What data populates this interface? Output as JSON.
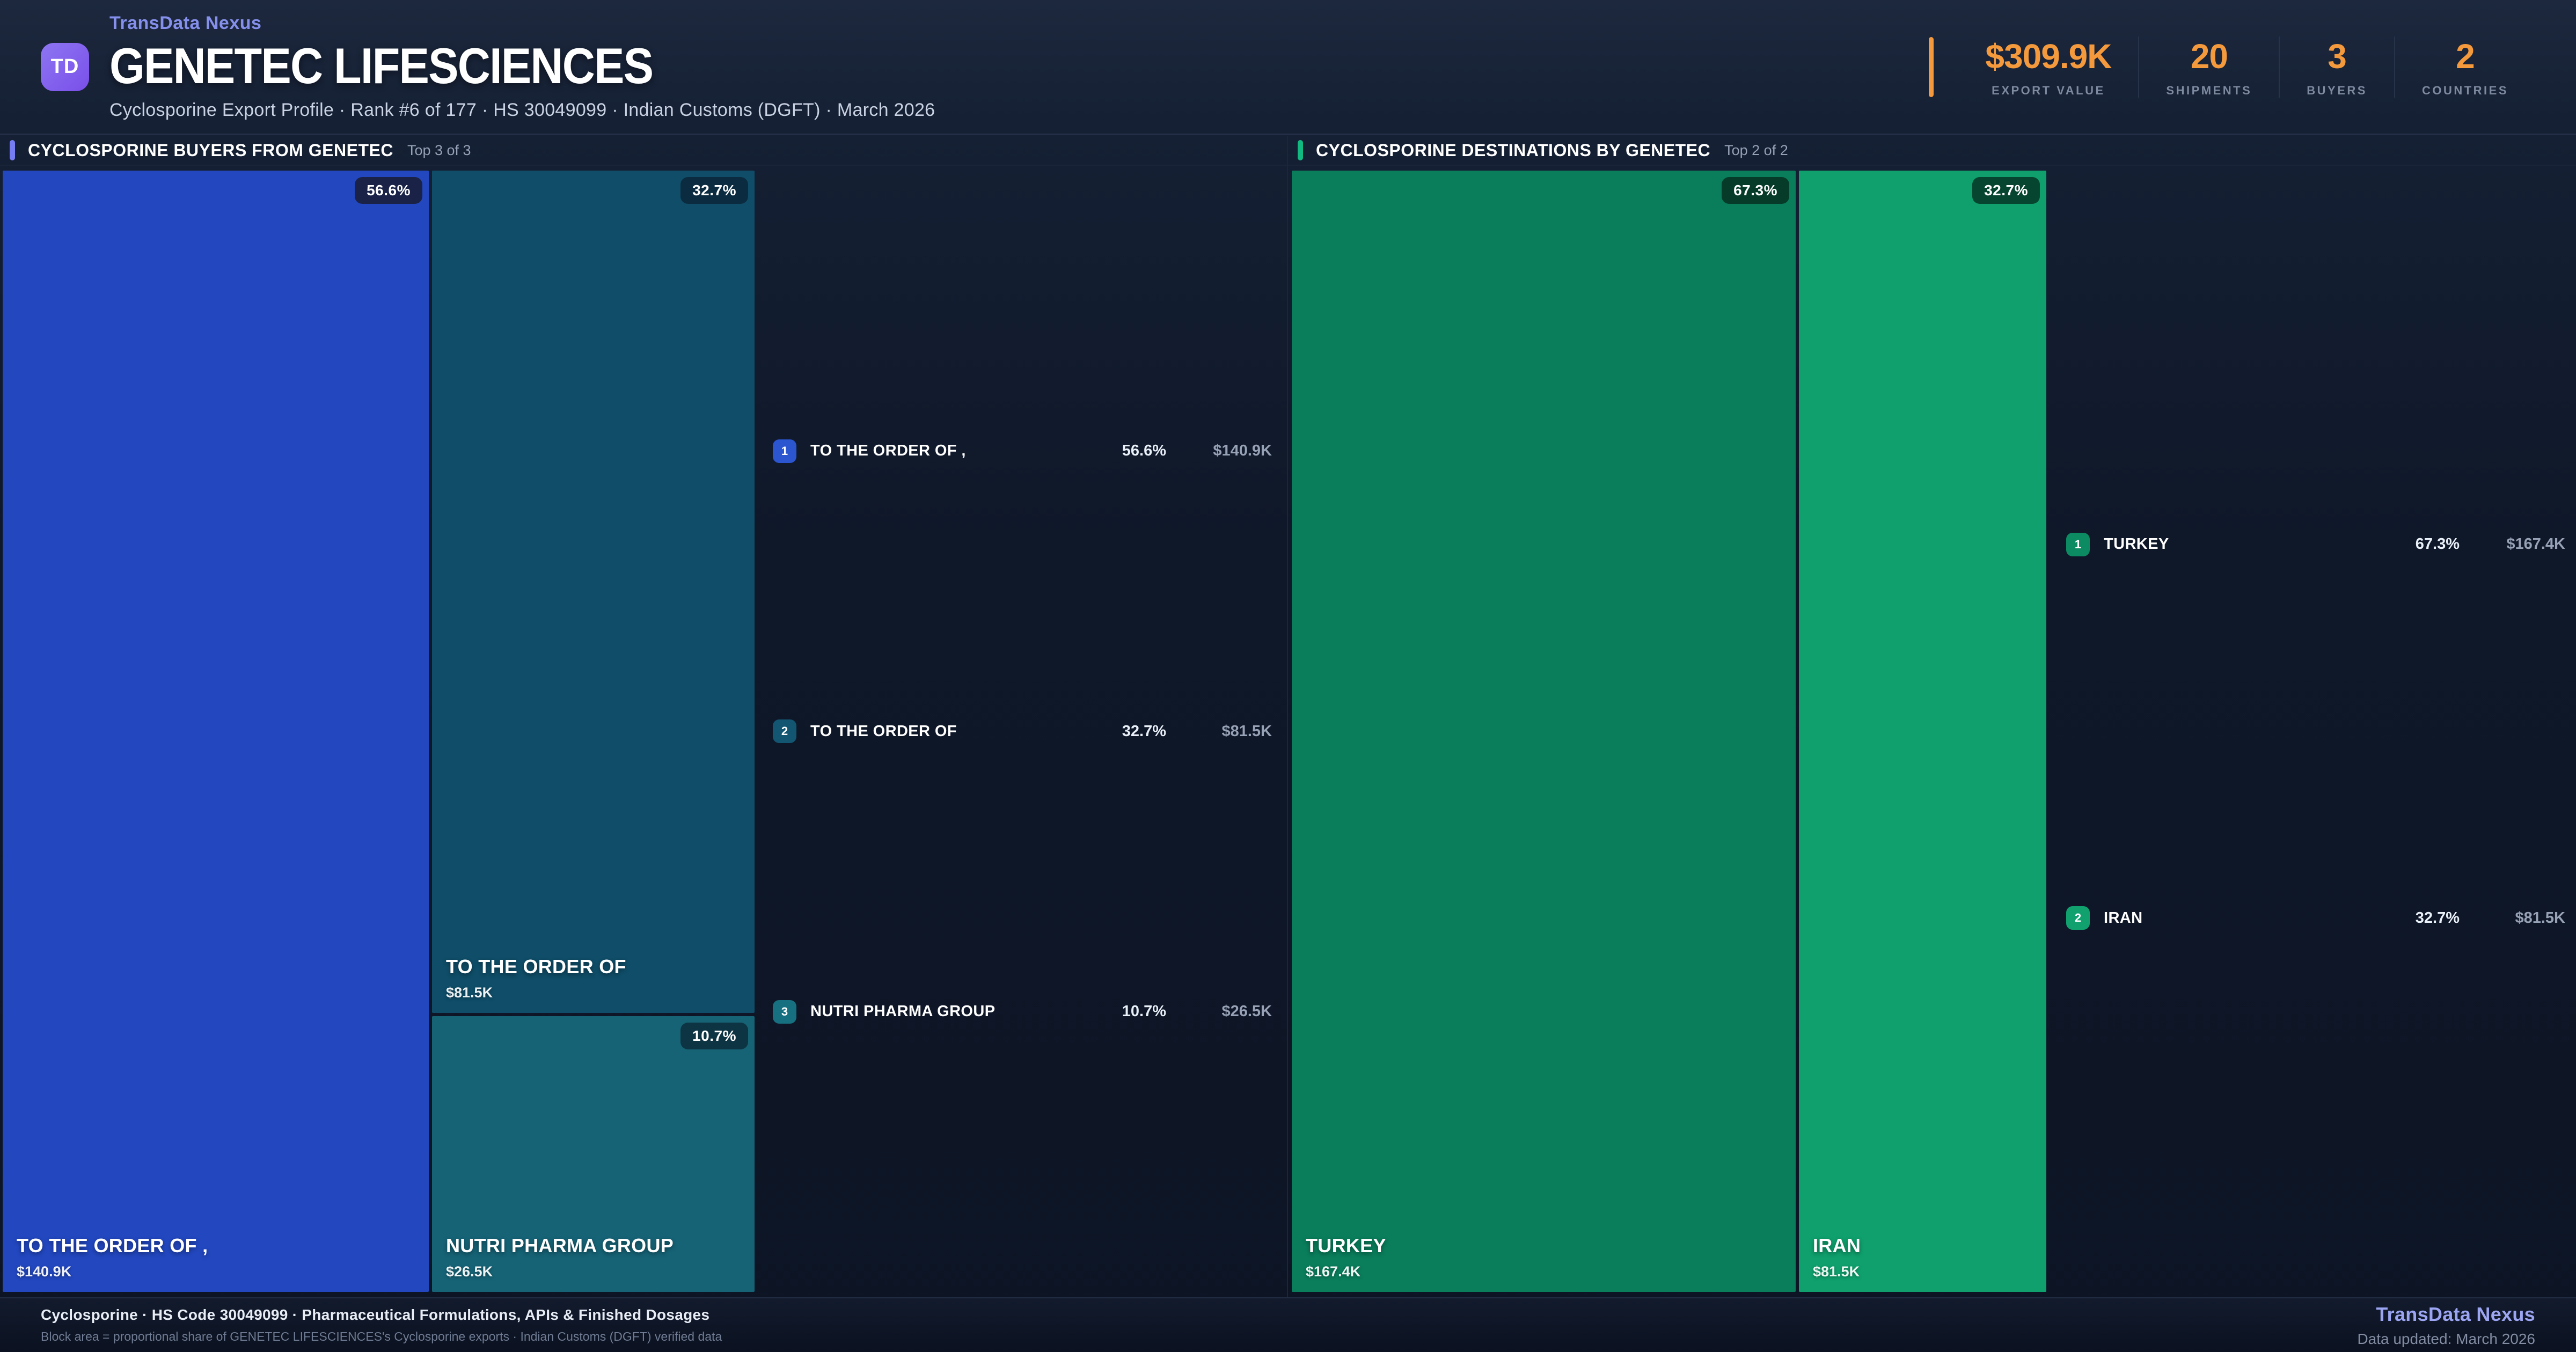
{
  "brand": {
    "logo": "TD",
    "name": "TransData Nexus"
  },
  "header": {
    "title": "GENETEC LIFESCIENCES",
    "subtitle": "Cyclosporine Export Profile · Rank #6 of 177 · HS 30049099 · Indian Customs (DGFT) · March 2026",
    "accent_color": "#f59a3c",
    "stats": [
      {
        "value": "$309.9K",
        "label": "EXPORT VALUE"
      },
      {
        "value": "20",
        "label": "SHIPMENTS"
      },
      {
        "value": "3",
        "label": "BUYERS"
      },
      {
        "value": "2",
        "label": "COUNTRIES"
      }
    ]
  },
  "buyers": {
    "title": "CYCLOSPORINE BUYERS FROM GENETEC",
    "top_note": "Top 3 of 3",
    "accent_color": "#767df3",
    "blocks": [
      {
        "name": "TO THE ORDER OF ,",
        "value": "$140.9K",
        "pct": "56.6%",
        "color": "#2247bf",
        "chip_color": "#1a2347"
      },
      {
        "name": "TO THE ORDER OF",
        "value": "$81.5K",
        "pct": "32.7%",
        "color": "#0f4d68",
        "chip_color": "#0b2c40"
      },
      {
        "name": "NUTRI PHARMA GROUP",
        "value": "$26.5K",
        "pct": "10.7%",
        "color": "#166376",
        "chip_color": "#0d3443"
      }
    ],
    "list": [
      {
        "rank": "1",
        "name": "TO THE ORDER OF ,",
        "pct": "56.6%",
        "value": "$140.9K",
        "badge_color": "#2c55d0"
      },
      {
        "rank": "2",
        "name": "TO THE ORDER OF",
        "pct": "32.7%",
        "value": "$81.5K",
        "badge_color": "#135672"
      },
      {
        "rank": "3",
        "name": "NUTRI PHARMA GROUP",
        "pct": "10.7%",
        "value": "$26.5K",
        "badge_color": "#17707f"
      }
    ]
  },
  "destinations": {
    "title": "CYCLOSPORINE DESTINATIONS BY GENETEC",
    "top_note": "Top 2 of 2",
    "accent_color": "#12b981",
    "blocks": [
      {
        "name": "TURKEY",
        "value": "$167.4K",
        "pct": "67.3%",
        "color": "#0a7d5b",
        "chip_color": "#053b28"
      },
      {
        "name": "IRAN",
        "value": "$81.5K",
        "pct": "32.7%",
        "color": "#0fa06d",
        "chip_color": "#06452f"
      }
    ],
    "list": [
      {
        "rank": "1",
        "name": "TURKEY",
        "pct": "67.3%",
        "value": "$167.4K",
        "badge_color": "#0c8a62"
      },
      {
        "rank": "2",
        "name": "IRAN",
        "pct": "32.7%",
        "value": "$81.5K",
        "badge_color": "#10a16f"
      }
    ]
  },
  "footer": {
    "line1": "Cyclosporine · HS Code 30049099 · Pharmaceutical Formulations, APIs & Finished Dosages",
    "line2": "Block area = proportional share of GENETEC LIFESCIENCES's Cyclosporine exports · Indian Customs (DGFT) verified data",
    "brand": "TransData Nexus",
    "updated": "Data updated: March 2026"
  },
  "chart_data": [
    {
      "type": "treemap",
      "title": "CYCLOSPORINE BUYERS FROM GENETEC",
      "subtitle": "Top 3 of 3",
      "unit": "USD thousands",
      "items": [
        {
          "label": "TO THE ORDER OF ,",
          "share_pct": 56.6,
          "value_usd_k": 140.9
        },
        {
          "label": "TO THE ORDER OF",
          "share_pct": 32.7,
          "value_usd_k": 81.5
        },
        {
          "label": "NUTRI PHARMA GROUP",
          "share_pct": 10.7,
          "value_usd_k": 26.5
        }
      ]
    },
    {
      "type": "treemap",
      "title": "CYCLOSPORINE DESTINATIONS BY GENETEC",
      "subtitle": "Top 2 of 2",
      "unit": "USD thousands",
      "items": [
        {
          "label": "TURKEY",
          "share_pct": 67.3,
          "value_usd_k": 167.4
        },
        {
          "label": "IRAN",
          "share_pct": 32.7,
          "value_usd_k": 81.5
        }
      ]
    }
  ]
}
